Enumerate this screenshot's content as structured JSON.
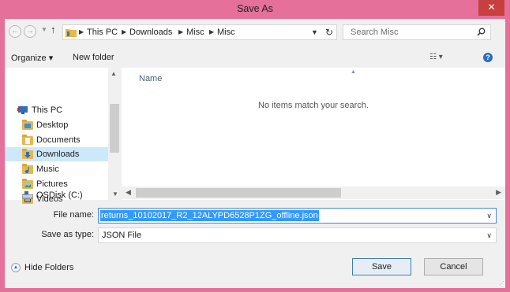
{
  "window": {
    "title": "Save As",
    "close_icon": "✕"
  },
  "address_bar": {
    "crumbs": [
      "This PC",
      "Downloads",
      "Misc",
      "Misc"
    ],
    "search_placeholder": "Search Misc"
  },
  "toolbar": {
    "organize_label": "Organize ▾",
    "new_folder_label": "New folder",
    "view_label": "☷ ▾",
    "help_label": "?"
  },
  "nav_pane": {
    "items": [
      {
        "label": "This PC",
        "icon": "pc-icon"
      },
      {
        "label": "Desktop",
        "icon": "desktop-folder-icon"
      },
      {
        "label": "Documents",
        "icon": "documents-folder-icon"
      },
      {
        "label": "Downloads",
        "icon": "downloads-folder-icon",
        "selected": true
      },
      {
        "label": "Music",
        "icon": "music-folder-icon"
      },
      {
        "label": "Pictures",
        "icon": "pictures-folder-icon"
      },
      {
        "label": "Videos",
        "icon": "videos-folder-icon"
      },
      {
        "label": "OSDisk (C:)",
        "icon": "drive-icon"
      }
    ]
  },
  "file_pane": {
    "column_name": "Name",
    "empty_message": "No items match your search."
  },
  "form": {
    "file_name_label": "File name:",
    "file_name_value": "returns_10102017_R2_12ALYPD6528P1ZG_offline.json",
    "save_type_label": "Save as type:",
    "save_type_value": "JSON File"
  },
  "footer": {
    "hide_folders_label": "Hide Folders",
    "save_label": "Save",
    "cancel_label": "Cancel"
  },
  "colors": {
    "frame": "#e5709a",
    "close": "#c7403f",
    "selection": "#3399ff",
    "nav_selected": "#cde8fb"
  }
}
